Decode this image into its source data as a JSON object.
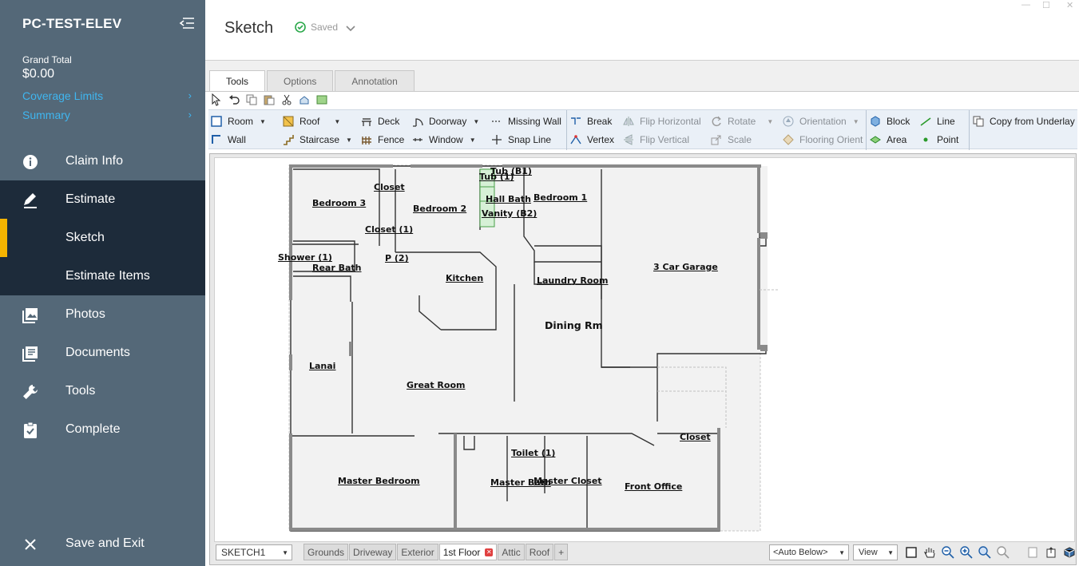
{
  "app": {
    "title": "PC-TEST-ELEV",
    "grand_total_label": "Grand Total",
    "grand_total_value": "$0.00",
    "links": [
      {
        "label": "Coverage Limits",
        "icon": "chevron-right-icon"
      },
      {
        "label": "Summary",
        "icon": "chevron-right-icon"
      }
    ]
  },
  "nav": {
    "claim_info": "Claim Info",
    "estimate": "Estimate",
    "sketch": "Sketch",
    "estimate_items": "Estimate Items",
    "photos": "Photos",
    "documents": "Documents",
    "tools": "Tools",
    "complete": "Complete",
    "save_exit": "Save and Exit"
  },
  "header": {
    "title": "Sketch",
    "status": "Saved"
  },
  "ribbon": {
    "tabs": [
      "Tools",
      "Options",
      "Annotation"
    ],
    "active_tab": "Tools",
    "tools": {
      "room": "Room",
      "wall": "Wall",
      "roof": "Roof",
      "staircase": "Staircase",
      "deck": "Deck",
      "fence": "Fence",
      "doorway": "Doorway",
      "window": "Window",
      "missing_wall": "Missing Wall",
      "snap_line": "Snap Line",
      "break": "Break",
      "vertex": "Vertex",
      "flip_horizontal": "Flip Horizontal",
      "flip_vertical": "Flip Vertical",
      "rotate": "Rotate",
      "scale": "Scale",
      "orientation": "Orientation",
      "flooring_orient": "Flooring Orient",
      "block": "Block",
      "area": "Area",
      "line": "Line",
      "point": "Point",
      "copy_underlay": "Copy from Underlay"
    }
  },
  "plan": {
    "rooms": {
      "bedroom3": "Bedroom 3",
      "closet_a": "Closet",
      "bedroom2": "Bedroom 2",
      "tub_b1": "Tub (B1)",
      "tub_1": "Tub  (1)",
      "hall_bath": "Hall Bath",
      "vanity_b2": "Vanity (B2)",
      "bedroom1": "Bedroom 1",
      "closet_1": "Closet  (1)",
      "shower_1": "Shower  (1)",
      "p_2": "P  (2)",
      "rear_bath": "Rear Bath",
      "kitchen": "Kitchen",
      "laundry": "Laundry Room",
      "garage": "3 Car Garage",
      "dining": "Dining Rm",
      "lanai": "Lanai",
      "great_room": "Great Room",
      "closet_b": "Closet",
      "toilet_1": "Toilet  (1)",
      "master_bedroom": "Master Bedroom",
      "master_bath": "Master Bath",
      "master_closet": "Master Closet",
      "front_office": "Front Office"
    }
  },
  "bottom": {
    "sheet": "SKETCH1",
    "floors": [
      "Grounds",
      "Driveway",
      "Exterior",
      "1st Floor",
      "Attic",
      "Roof",
      "+"
    ],
    "active_floor": "1st Floor",
    "auto_below": "<Auto Below>",
    "view": "View"
  },
  "colors": {
    "sidebar": "#546878",
    "sidebar_active": "#1d2b3a",
    "accent": "#f5b400",
    "link": "#3fb6f0",
    "saved_check": "#2aa84a"
  }
}
